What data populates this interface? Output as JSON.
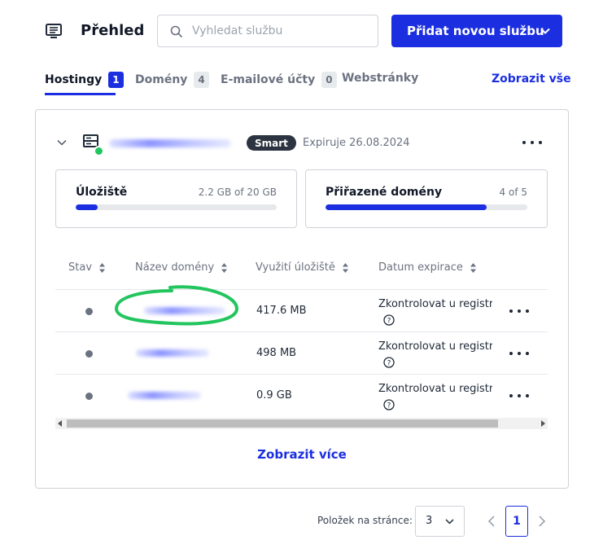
{
  "header": {
    "title": "Přehled",
    "icon": "list-icon",
    "search_placeholder": "Vyhledat službu",
    "add_button_label": "Přidat novou službu"
  },
  "tabs": [
    {
      "label": "Hostingy",
      "count": "1",
      "active": true
    },
    {
      "label": "Domény",
      "count": "4",
      "active": false
    },
    {
      "label": "E-mailové účty",
      "count": "0",
      "active": false
    },
    {
      "label": "Webstránky",
      "count": "",
      "active": false
    }
  ],
  "show_all_label": "Zobrazit vše",
  "hosting": {
    "plan_badge": "Smart",
    "expiry": "Expiruje 26.08.2024",
    "status_color": "#22c55e",
    "storage": {
      "label": "Úložiště",
      "value": "2.2 GB of 20 GB",
      "used_fraction": 0.11
    },
    "domains": {
      "label": "Přiřazené domény",
      "value": "4 of 5",
      "used_fraction": 0.8
    }
  },
  "table": {
    "columns": [
      "Stav",
      "Název domény",
      "Využití úložiště",
      "Datum expirace"
    ],
    "rows": [
      {
        "usage": "417.6 MB",
        "expiry": "Zkontrolovat u registrátora"
      },
      {
        "usage": "498 MB",
        "expiry": "Zkontrolovat u registrátora"
      },
      {
        "usage": "0.9 GB",
        "expiry": "Zkontrolovat u registrátora"
      }
    ]
  },
  "show_more_label": "Zobrazit více",
  "pagination": {
    "per_page_label": "Položek na stránce:",
    "per_page_value": "3",
    "current_page": "1"
  },
  "colors": {
    "accent": "#1b2fe0",
    "status_online": "#22c55e"
  }
}
